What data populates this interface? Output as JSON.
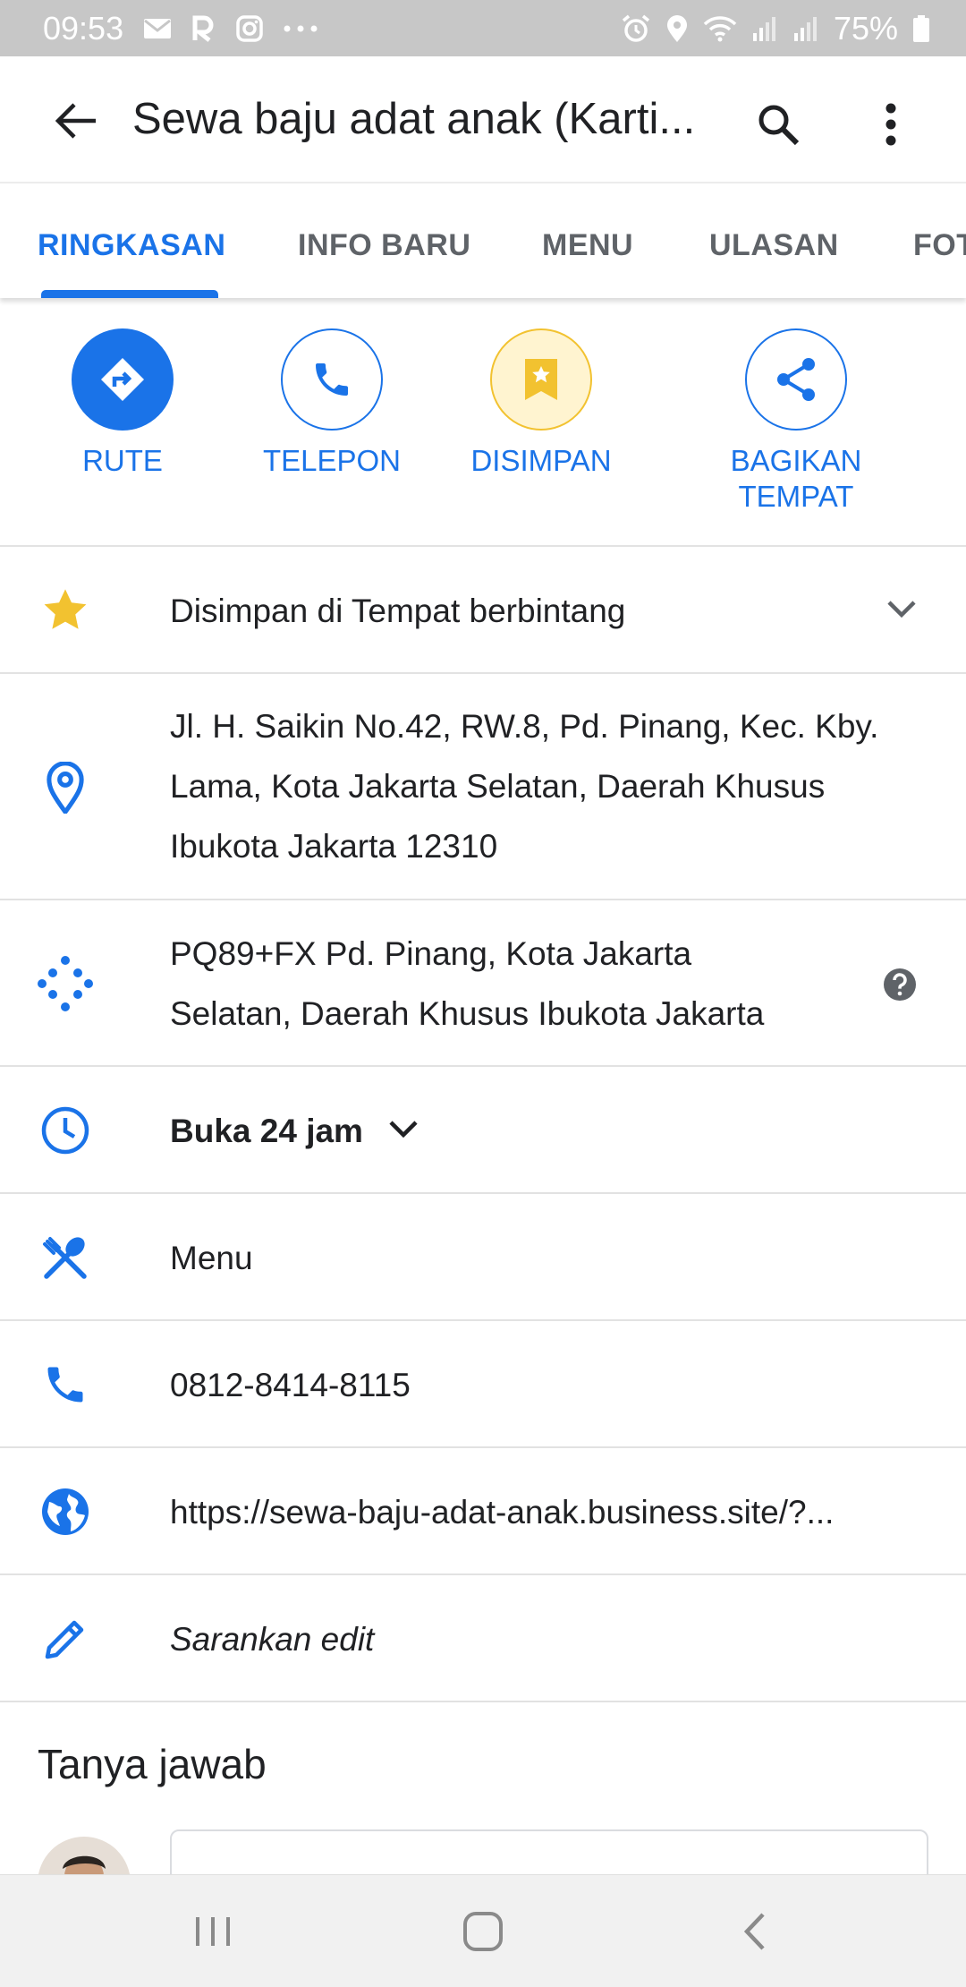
{
  "status_bar": {
    "time": "09:53",
    "battery": "75%"
  },
  "app_bar": {
    "title": "Sewa baju adat anak (Karti..."
  },
  "tabs": [
    {
      "label": "RINGKASAN"
    },
    {
      "label": "INFO BARU"
    },
    {
      "label": "MENU"
    },
    {
      "label": "ULASAN"
    },
    {
      "label": "FOT"
    }
  ],
  "actions": [
    {
      "label": "RUTE"
    },
    {
      "label": "TELEPON"
    },
    {
      "label": "DISIMPAN"
    },
    {
      "label": "BAGIKAN\nTEMPAT"
    }
  ],
  "rows": {
    "saved": "Disimpan di Tempat berbintang",
    "address": [
      "Jl. H. Saikin No.42, RW.8, Pd. Pinang, Kec. Kby.",
      "Lama, Kota Jakarta Selatan, Daerah Khusus",
      "Ibukota Jakarta 12310"
    ],
    "plus_code": [
      "PQ89+FX Pd. Pinang, Kota Jakarta",
      "Selatan, Daerah Khusus Ibukota Jakarta"
    ],
    "hours": "Buka 24 jam",
    "menu": "Menu",
    "phone": "0812-8414-8115",
    "website": "https://sewa-baju-adat-anak.business.site/?...",
    "suggest_edit": "Sarankan edit"
  },
  "qa": {
    "title": "Tanya jawab"
  },
  "colors": {
    "accent": "#1a73e8",
    "star": "#f2c230",
    "text": "#202124",
    "muted": "#5f6368"
  }
}
